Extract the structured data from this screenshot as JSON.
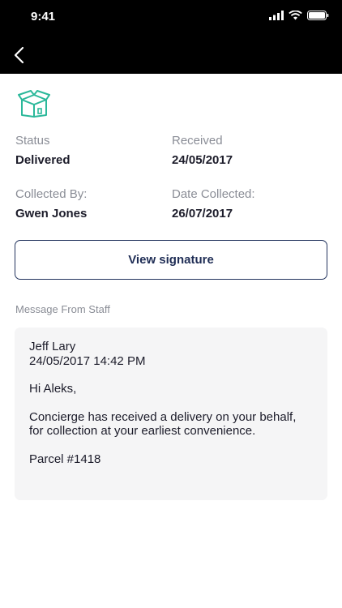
{
  "status_bar": {
    "time": "9:41"
  },
  "nav": {
    "back_icon": "chevron-left-icon"
  },
  "package": {
    "icon": "package-box-icon",
    "status_label": "Status",
    "status_value": "Delivered",
    "received_label": "Received",
    "received_value": "24/05/2017",
    "collected_by_label": "Collected By:",
    "collected_by_value": "Gwen Jones",
    "date_collected_label": "Date Collected:",
    "date_collected_value": "26/07/2017"
  },
  "actions": {
    "view_signature_label": "View signature"
  },
  "message": {
    "section_title": "Message From Staff",
    "sender": "Jeff Lary",
    "timestamp": "24/05/2017 14:42 PM",
    "greeting": "Hi Aleks,",
    "body": "Concierge has received a delivery on your behalf, for collection at your earliest convenience.",
    "parcel": "Parcel #1418"
  },
  "colors": {
    "accent": "#23345e",
    "icon": "#2bb89a",
    "card": "#f5f5f6",
    "muted": "#8a8d96"
  }
}
